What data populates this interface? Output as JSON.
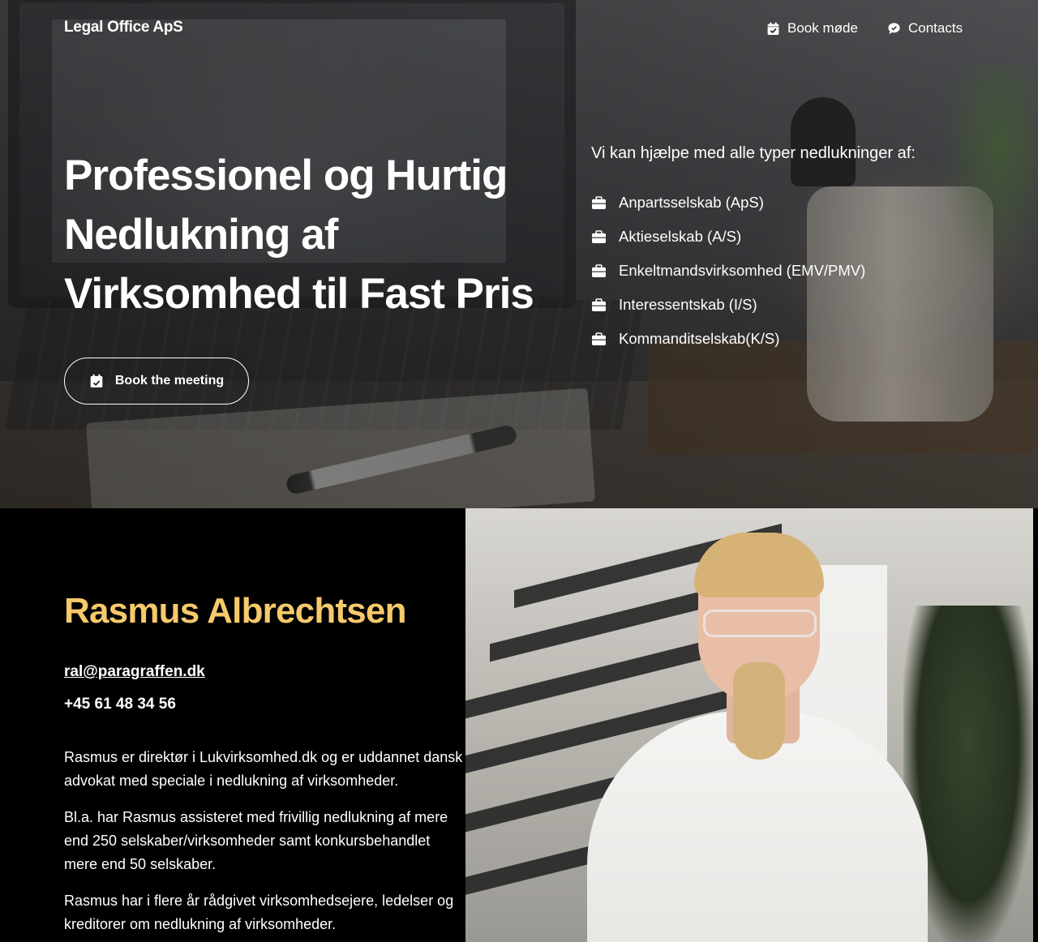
{
  "header": {
    "brand": "Legal Office ApS",
    "nav": {
      "book_label": "Book møde",
      "contacts_label": "Contacts"
    }
  },
  "hero": {
    "title": "Professionel og Hurtig Nedlukning af Virksomhed til Fast Pris",
    "cta_label": "Book the meeting",
    "help_heading": "Vi kan hjælpe med alle typer nedlukninger af:",
    "company_types": [
      "Anpartsselskab (ApS)",
      "Aktieselskab (A/S)",
      "Enkeltmandsvirksomhed (EMV/PMV)",
      "Interessentskab (I/S)",
      "Kommanditselskab(K/S)"
    ]
  },
  "profile": {
    "name": "Rasmus Albrechtsen",
    "email": "ral@paragraffen.dk",
    "phone": "+45 61 48 34 56",
    "paragraphs": [
      "Rasmus er direktør i Lukvirksomhed.dk og er uddannet dansk advokat med speciale i nedlukning af virksomheder.",
      "Bl.a. har Rasmus assisteret med frivillig nedlukning af mere end 250 selskaber/virksomheder samt konkursbehandlet mere end 50 selskaber.",
      "Rasmus har i flere år rådgivet virksomhedsejere, ledelser og kreditorer om nedlukning af virksomheder."
    ]
  },
  "colors": {
    "accent_name": "#f6c96b",
    "background": "#000000",
    "text": "#ffffff"
  },
  "icons": {
    "book": "calendar-check-icon",
    "contacts": "chat-bubble-icon",
    "company_type": "briefcase-icon"
  }
}
